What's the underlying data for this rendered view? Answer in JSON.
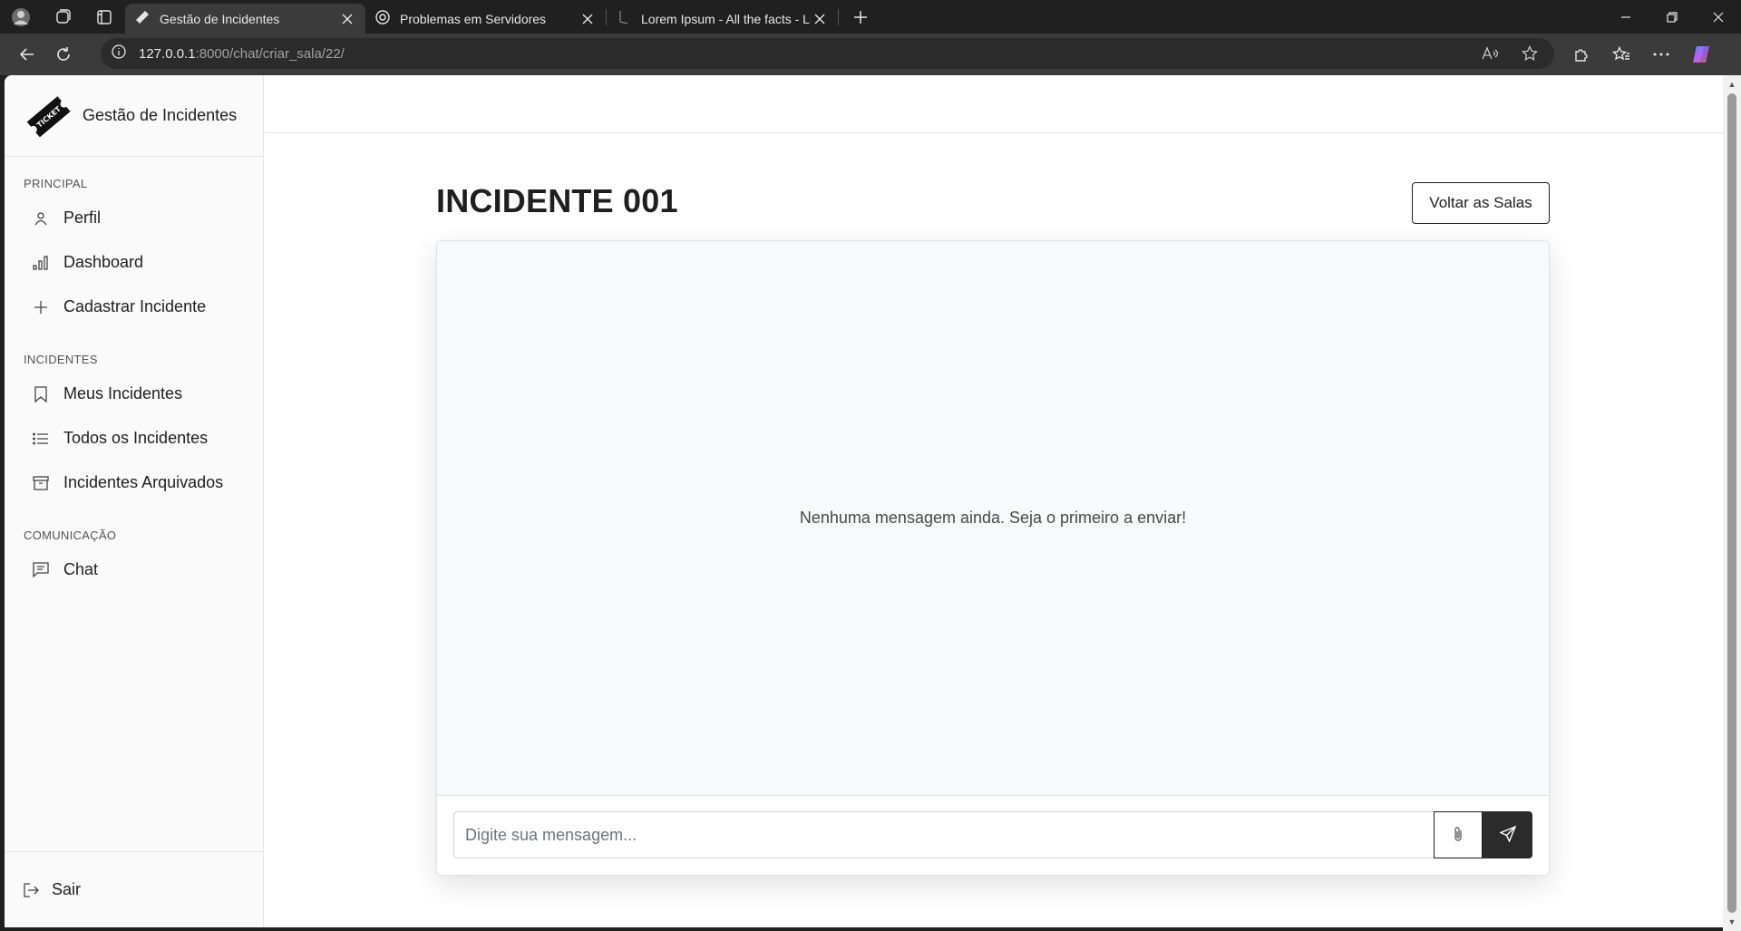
{
  "browser": {
    "tabs": [
      {
        "title": "Gestão de Incidentes",
        "active": true,
        "icon": "ticket-icon"
      },
      {
        "title": "Problemas em Servidores",
        "active": false,
        "icon": "chatgpt-icon"
      },
      {
        "title": "Lorem Ipsum - All the facts - Lipsum",
        "active": false,
        "icon": "lipsum-icon"
      }
    ],
    "url_host": "127.0.0.1",
    "url_path": ":8000/chat/criar_sala/22/"
  },
  "sidebar": {
    "brand": "Gestão de Incidentes",
    "sections": [
      {
        "title": "PRINCIPAL",
        "items": [
          {
            "label": "Perfil",
            "icon": "user-icon"
          },
          {
            "label": "Dashboard",
            "icon": "bar-chart-icon"
          },
          {
            "label": "Cadastrar Incidente",
            "icon": "plus-icon"
          }
        ]
      },
      {
        "title": "INCIDENTES",
        "items": [
          {
            "label": "Meus Incidentes",
            "icon": "bookmark-icon"
          },
          {
            "label": "Todos os Incidentes",
            "icon": "list-icon"
          },
          {
            "label": "Incidentes Arquivados",
            "icon": "archive-icon"
          }
        ]
      },
      {
        "title": "COMUNICAÇÃO",
        "items": [
          {
            "label": "Chat",
            "icon": "chat-icon"
          }
        ]
      }
    ],
    "logout": "Sair"
  },
  "main": {
    "title": "INCIDENTE 001",
    "back_button": "Voltar as Salas",
    "empty_message": "Nenhuma mensagem ainda. Seja o primeiro a enviar!",
    "input_placeholder": "Digite sua mensagem..."
  }
}
